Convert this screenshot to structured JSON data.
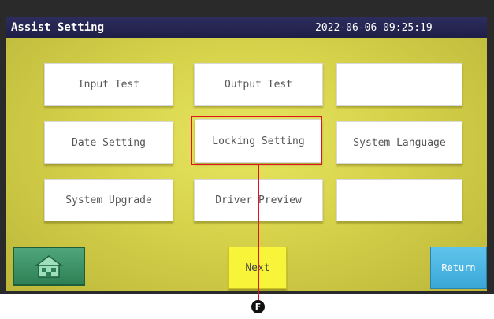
{
  "titlebar": {
    "title": "Assist Setting",
    "datetime": "2022-06-06 09:25:19"
  },
  "grid": {
    "input_test": "Input Test",
    "output_test": "Output Test",
    "empty_1": "",
    "date_setting": "Date Setting",
    "locking_setting": "Locking Setting",
    "system_language": "System Language",
    "system_upgrade": "System Upgrade",
    "driver_preview": "Driver Preview",
    "empty_2": ""
  },
  "footer": {
    "home_icon": "home-icon",
    "next_label": "Next",
    "return_label": "Return"
  },
  "callout": {
    "marker": "F"
  },
  "colors": {
    "screen": "#d6d24a",
    "titlebar": "#1e1e46",
    "highlight": "#e0141e",
    "next": "#f7f43a",
    "return": "#3aa7d8",
    "home": "#2f7f55"
  }
}
